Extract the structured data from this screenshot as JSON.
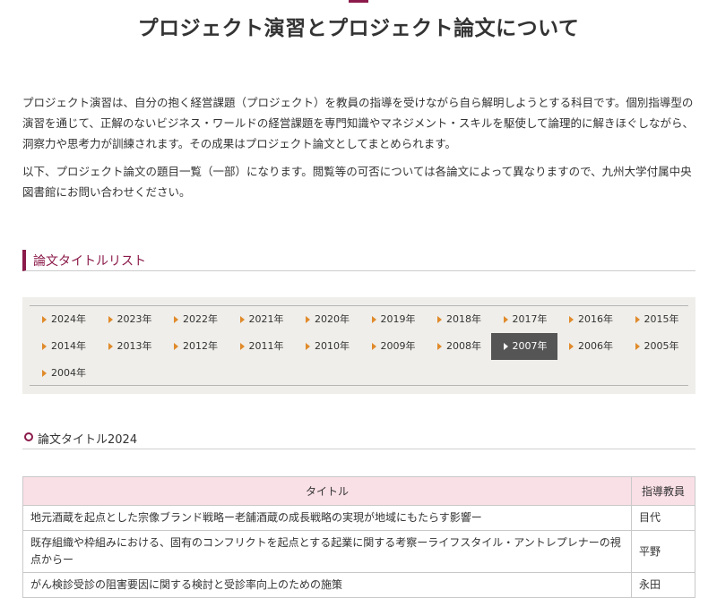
{
  "page": {
    "title": "プロジェクト演習とプロジェクト論文について",
    "intro": [
      "プロジェクト演習は、自分の抱く経営課題（プロジェクト）を教員の指導を受けながら自ら解明しようとする科目です。個別指導型の演習を通じて、正解のないビジネス・ワールドの経営課題を専門知識やマネジメント・スキルを駆使して論理的に解きほぐしながら、洞察力や思考力が訓練されます。その成果はプロジェクト論文としてまとめられます。",
      "以下、プロジェクト論文の題目一覧（一部）になります。閲覧等の可否については各論文によって異なりますので、九州大学付属中央図書館にお問い合わせください。"
    ]
  },
  "section": {
    "heading": "論文タイトルリスト"
  },
  "years": [
    "2024年",
    "2023年",
    "2022年",
    "2021年",
    "2020年",
    "2019年",
    "2018年",
    "2017年",
    "2016年",
    "2015年",
    "2014年",
    "2013年",
    "2012年",
    "2011年",
    "2010年",
    "2009年",
    "2008年",
    "2007年",
    "2006年",
    "2005年",
    "2004年"
  ],
  "active_year": "2007年",
  "subsection": {
    "heading": "論文タイトル2024"
  },
  "table": {
    "headers": {
      "title": "タイトル",
      "advisor": "指導教員"
    },
    "rows": [
      {
        "title": "地元酒蔵を起点とした宗像ブランド戦略ー老舗酒蔵の成長戦略の実現が地域にもたらす影響ー",
        "advisor": "目代"
      },
      {
        "title": "既存組織や枠組みにおける、固有のコンフリクトを起点とする起業に関する考察ーライフスタイル・アントレプレナーの視点からー",
        "advisor": "平野"
      },
      {
        "title": "がん検診受診の阻害要因に関する検討と受診率向上のための施策",
        "advisor": "永田"
      }
    ]
  },
  "colors": {
    "accent": "#8b1a4a",
    "table_header_bg": "#f9dfe6",
    "year_panel_bg": "#efeeea",
    "active_year_bg": "#555555",
    "triangle": "#e08a2a"
  },
  "icons": {
    "year_marker": "triangle-right-icon",
    "subheading_marker": "circle-icon"
  }
}
